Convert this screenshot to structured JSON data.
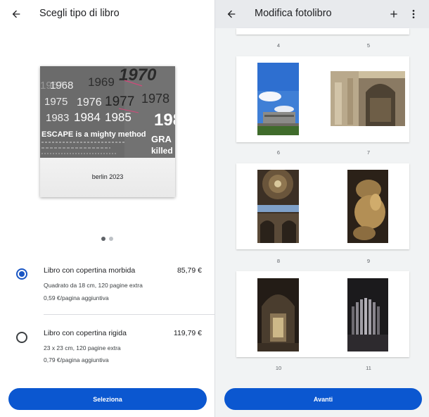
{
  "left": {
    "title": "Scegli tipo di libro",
    "book": {
      "title": "berlin 2023",
      "cover_years": [
        "1970",
        "1969",
        "1968",
        "1967",
        "1976",
        "1977",
        "1978",
        "1975",
        "1983",
        "1984",
        "1985",
        "198"
      ],
      "cover_phrase": "ESCAPE is a mighty method",
      "cover_fragment_1": "GRA",
      "cover_fragment_2": "killed"
    },
    "carousel": {
      "count": 2,
      "active": 1
    },
    "options": [
      {
        "name": "Libro con copertina morbida",
        "price": "85,79 €",
        "details": "Quadrato da 18 cm, 120 pagine extra",
        "per_page": "0,59 €/pagina aggiuntiva",
        "selected": true
      },
      {
        "name": "Libro con copertina rigida",
        "price": "119,79 €",
        "details": "23 x 23 cm, 120 pagine extra",
        "per_page": "0,79 €/pagina aggiuntiva",
        "selected": false
      }
    ],
    "button_label": "Seleziona"
  },
  "right": {
    "title": "Modifica fotolibro",
    "top_page_numbers": [
      "4",
      "5"
    ],
    "spreads": [
      {
        "left_page": "6",
        "right_page": "7"
      },
      {
        "left_page": "8",
        "right_page": "9"
      },
      {
        "left_page": "10",
        "right_page": "11"
      }
    ],
    "button_label": "Avanti"
  },
  "colors": {
    "primary": "#0b57d0",
    "right_bg": "#f1f3f4",
    "header_bg": "#e8eaed"
  },
  "icons": {
    "back": "arrow-left-icon",
    "add": "plus-icon",
    "more": "more-vert-icon"
  }
}
